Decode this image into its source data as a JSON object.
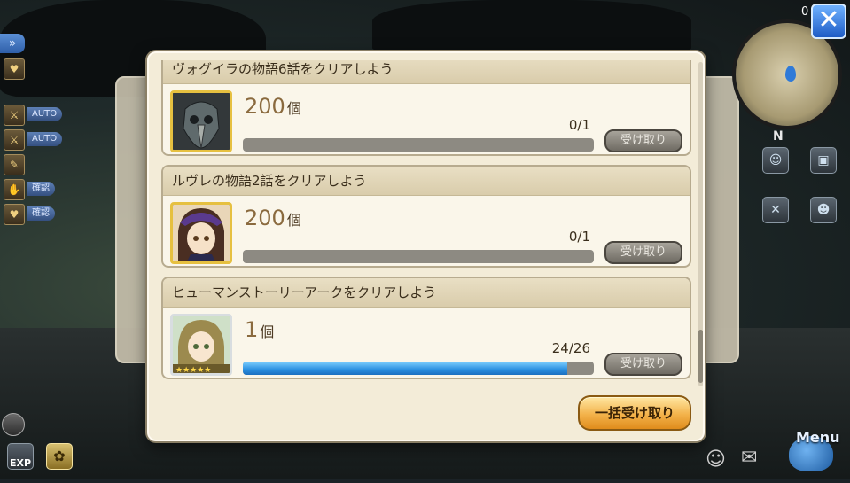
{
  "hud": {
    "counter_value": "0",
    "compass_label": "N",
    "auto_label_1": "AUTO",
    "auto_label_2": "AUTO",
    "confirm_label_1": "確認",
    "confirm_label_2": "確認",
    "exp_label": "EXP",
    "menu_label": "Menu"
  },
  "missions": [
    {
      "title": "ヴォグイラの物語6話をクリアしよう",
      "reward_amount": "200",
      "reward_unit": "個",
      "progress_text": "0/1",
      "progress_fraction": 0,
      "claim_label": "受け取り"
    },
    {
      "title": "ルヴレの物語2話をクリアしよう",
      "reward_amount": "200",
      "reward_unit": "個",
      "progress_text": "0/1",
      "progress_fraction": 0,
      "claim_label": "受け取り"
    },
    {
      "title": "ヒューマンストーリーアークをクリアしよう",
      "reward_amount": "1",
      "reward_unit": "個",
      "progress_text": "24/26",
      "progress_fraction": 0.923,
      "claim_label": "受け取り"
    }
  ],
  "bulk_claim_label": "一括受け取り",
  "colors": {
    "progress_fill": "#2a8fe0",
    "bulk_button": "#f3b24a",
    "close_button": "#1e5cc6"
  }
}
